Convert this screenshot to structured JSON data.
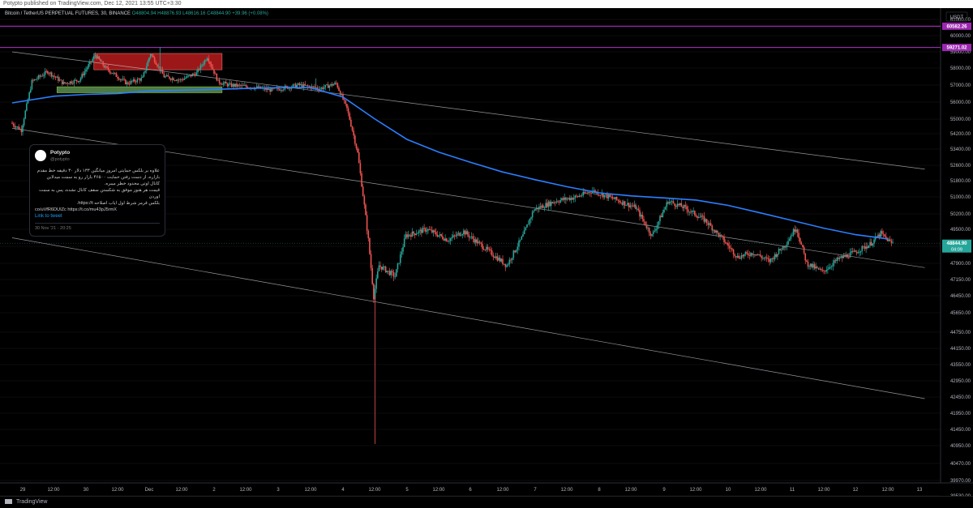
{
  "header": {
    "text": "Potypto published on TradingView.com, Dec 12, 2021 13:55 UTC+3:30"
  },
  "legend": {
    "symbol": "Bitcoin / TetherUS PERPETUAL FUTURES, 30, BINANCE",
    "o": "O48804.94",
    "h": "H48876.93",
    "l": "L48616.16",
    "c": "C48844.90",
    "chg": "+39.96 (+0.08%)"
  },
  "currency": "USDT",
  "tweet": {
    "name": "Potypto",
    "handle": "@potypto",
    "body_line1": "علاوه بر بلکس حمایتی امروز میانگین ۱۳۳ دلار ۳۰ دقیقه خط مقدم",
    "body_line2": "بازاره، از دست رفتن حمایت ۴۶۵۰۰ بازار رو به سمت میدلاین",
    "body_line3": "کانال اوتی محدود خطر میبره.",
    "body_line4": "قیمت هر هنوز موفق به شکستن سقف کانال نشده، پس به سمت اوردن",
    "body_line5": "بلکس قرمز شرط اول ایاب اصلاحه https://t.",
    "body_line6": "co/uVfR6DUIZc https://t.co/mu43pJ5rmX",
    "link": "Link to tweet",
    "date": "30 Nov '21 · 20:25"
  },
  "footer": {
    "brand": "TradingView"
  },
  "colors": {
    "up": "#26a69a",
    "down": "#ef5350",
    "ma": "#2a7fff",
    "purple": "#9c27b0",
    "box_red": "#b71c1c",
    "box_green": "#5b8f4e"
  },
  "chart_data": {
    "type": "candlestick",
    "title": "Bitcoin / TetherUS PERPETUAL FUTURES, 30, BINANCE",
    "ylim": [
      39100,
      61550
    ],
    "y_ticks": [
      61000,
      60000,
      59000,
      58000,
      57000,
      56000,
      55000,
      54200,
      53400,
      52600,
      51800,
      51000,
      50200,
      49500,
      48700,
      47900,
      47150,
      46450,
      45650,
      44750,
      44150,
      43550,
      42950,
      42450,
      41950,
      41450,
      40950,
      40470,
      39970,
      39530
    ],
    "y_tick_labels": [
      "61000.00",
      "60000.00",
      "59000.00",
      "58000.00",
      "57000.00",
      "56000.00",
      "55000.00",
      "54200.00",
      "53400.00",
      "52600.00",
      "51800.00",
      "51000.00",
      "50200.00",
      "49500.00",
      "48700.00",
      "47900.00",
      "47150.00",
      "46450.00",
      "45650.00",
      "44750.00",
      "44150.00",
      "43550.00",
      "42950.00",
      "42450.00",
      "41950.00",
      "41450.00",
      "40950.00",
      "40470.00",
      "39970.00",
      "39530.00"
    ],
    "price_labels": [
      {
        "value": 60582.26,
        "label": "60582.26",
        "kind": "purple"
      },
      {
        "value": 59271.02,
        "label": "59271.02",
        "kind": "purple"
      },
      {
        "value": 48844.9,
        "label": "48844.90",
        "sub": "04:09",
        "kind": "current"
      }
    ],
    "x_tick_labels": [
      "29",
      "12:00",
      "30",
      "12:00",
      "Dec",
      "12:00",
      "2",
      "12:00",
      "3",
      "12:00",
      "4",
      "12:00",
      "5",
      "12:00",
      "6",
      "12:00",
      "7",
      "12:00",
      "8",
      "12:00",
      "9",
      "12:00",
      "10",
      "12:00",
      "11",
      "12:00",
      "12",
      "12:00",
      "13"
    ],
    "day_starts": [
      "Nov 29",
      "Nov 30",
      "Dec 1",
      "Dec 2",
      "Dec 3",
      "Dec 4",
      "Dec 5",
      "Dec 6",
      "Dec 7",
      "Dec 8",
      "Dec 9",
      "Dec 10",
      "Dec 11",
      "Dec 12",
      "Dec 13"
    ],
    "horizontal_lines": [
      60582.26,
      59271.02
    ],
    "trendlines": [
      {
        "from": [
          "Nov 28 20:00",
          59000
        ],
        "to": [
          "Dec 13 02:00",
          52400
        ]
      },
      {
        "from": [
          "Nov 28 20:00",
          54500
        ],
        "to": [
          "Dec 13 02:00",
          47700
        ]
      },
      {
        "from": [
          "Nov 28 20:00",
          49100
        ],
        "to": [
          "Dec 13 02:00",
          42400
        ]
      }
    ],
    "zones": [
      {
        "color": "red",
        "from": "Nov 30 03:00",
        "to": "Dec 2 03:00",
        "top": 58900,
        "bottom": 57900
      },
      {
        "color": "green",
        "from": "Nov 29 13:00",
        "to": "Dec 2 03:00",
        "top": 56900,
        "bottom": 56550
      }
    ],
    "moving_average_path": [
      [
        "Nov 28 20:00",
        55950
      ],
      [
        "Nov 29 12:00",
        56350
      ],
      [
        "Nov 30 00:00",
        56450
      ],
      [
        "Nov 30 12:00",
        56500
      ],
      [
        "Dec 1 00:00",
        56650
      ],
      [
        "Dec 1 12:00",
        56700
      ],
      [
        "Dec 2 00:00",
        56750
      ],
      [
        "Dec 2 12:00",
        56800
      ],
      [
        "Dec 3 00:00",
        56850
      ],
      [
        "Dec 3 12:00",
        56850
      ],
      [
        "Dec 4 00:00",
        56300
      ],
      [
        "Dec 4 12:00",
        55000
      ],
      [
        "Dec 5 00:00",
        53900
      ],
      [
        "Dec 5 12:00",
        53250
      ],
      [
        "Dec 6 00:00",
        52750
      ],
      [
        "Dec 6 12:00",
        52250
      ],
      [
        "Dec 7 00:00",
        51850
      ],
      [
        "Dec 7 12:00",
        51500
      ],
      [
        "Dec 8 00:00",
        51200
      ],
      [
        "Dec 8 12:00",
        51050
      ],
      [
        "Dec 9 00:00",
        50950
      ],
      [
        "Dec 9 12:00",
        50850
      ],
      [
        "Dec 10 00:00",
        50600
      ],
      [
        "Dec 10 12:00",
        50250
      ],
      [
        "Dec 11 00:00",
        49900
      ],
      [
        "Dec 11 12:00",
        49550
      ],
      [
        "Dec 12 00:00",
        49250
      ],
      [
        "Dec 12 12:00",
        49050
      ]
    ],
    "price_path": [
      [
        "Nov 28 20:00",
        54800
      ],
      [
        "Nov 29 00:00",
        54400
      ],
      [
        "Nov 29 04:00",
        57200
      ],
      [
        "Nov 29 10:00",
        57800
      ],
      [
        "Nov 29 16:00",
        57100
      ],
      [
        "Nov 29 22:00",
        57300
      ],
      [
        "Nov 30 04:00",
        58800
      ],
      [
        "Nov 30 08:00",
        58000
      ],
      [
        "Nov 30 16:00",
        57100
      ],
      [
        "Nov 30 22:00",
        57400
      ],
      [
        "Dec 1 01:00",
        58900
      ],
      [
        "Dec 1 06:00",
        57500
      ],
      [
        "Dec 1 12:00",
        57300
      ],
      [
        "Dec 1 18:00",
        57700
      ],
      [
        "Dec 1 22:00",
        58700
      ],
      [
        "Dec 2 02:00",
        57200
      ],
      [
        "Dec 2 06:00",
        57000
      ],
      [
        "Dec 2 14:00",
        56900
      ],
      [
        "Dec 2 22:00",
        56700
      ],
      [
        "Dec 3 08:00",
        57000
      ],
      [
        "Dec 3 16:00",
        56800
      ],
      [
        "Dec 3 22:00",
        57100
      ],
      [
        "Dec 4 02:00",
        55600
      ],
      [
        "Dec 4 06:00",
        53200
      ],
      [
        "Dec 4 10:00",
        49000
      ],
      [
        "Dec 4 12:00",
        46400
      ],
      [
        "Dec 4 14:00",
        47800
      ],
      [
        "Dec 4 20:00",
        47300
      ],
      [
        "Dec 5 00:00",
        49200
      ],
      [
        "Dec 5 08:00",
        49500
      ],
      [
        "Dec 5 16:00",
        49000
      ],
      [
        "Dec 5 22:00",
        49400
      ],
      [
        "Dec 6 04:00",
        48800
      ],
      [
        "Dec 6 10:00",
        48200
      ],
      [
        "Dec 6 14:00",
        47800
      ],
      [
        "Dec 6 20:00",
        49200
      ],
      [
        "Dec 7 00:00",
        50400
      ],
      [
        "Dec 7 08:00",
        50800
      ],
      [
        "Dec 7 16:00",
        51000
      ],
      [
        "Dec 7 22:00",
        51300
      ],
      [
        "Dec 8 06:00",
        50900
      ],
      [
        "Dec 8 14:00",
        50500
      ],
      [
        "Dec 8 20:00",
        49200
      ],
      [
        "Dec 9 02:00",
        50800
      ],
      [
        "Dec 9 08:00",
        50500
      ],
      [
        "Dec 9 16:00",
        49900
      ],
      [
        "Dec 9 22:00",
        49100
      ],
      [
        "Dec 10 04:00",
        48200
      ],
      [
        "Dec 10 10:00",
        48400
      ],
      [
        "Dec 10 16:00",
        48000
      ],
      [
        "Dec 10 22:00",
        48800
      ],
      [
        "Dec 11 02:00",
        49600
      ],
      [
        "Dec 11 06:00",
        47900
      ],
      [
        "Dec 11 12:00",
        47500
      ],
      [
        "Dec 11 18:00",
        48100
      ],
      [
        "Dec 12 00:00",
        48400
      ],
      [
        "Dec 12 06:00",
        48800
      ],
      [
        "Dec 12 10:00",
        49300
      ],
      [
        "Dec 12 14:00",
        48850
      ]
    ],
    "spikes": [
      [
        "Dec 4 12:00",
        41000
      ],
      [
        "Dec 3 14:00",
        57400
      ],
      [
        "Dec 1 04:00",
        59300
      ]
    ]
  }
}
